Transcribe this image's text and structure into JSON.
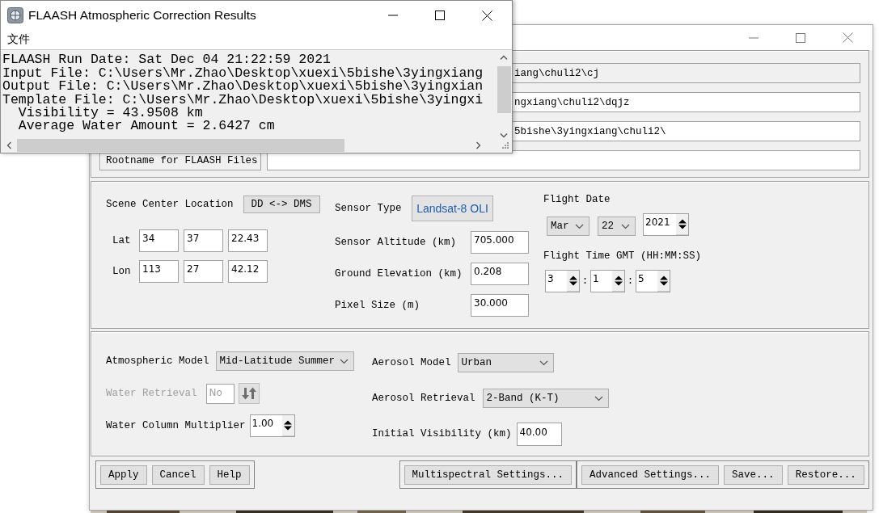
{
  "results_window": {
    "title": "FLAASH Atmospheric Correction Results",
    "menu": [
      "文件"
    ],
    "lines": [
      "FLAASH Run Date: Sat Dec 04 21:22:59 2021",
      "Input File: C:\\Users\\Mr.Zhao\\Desktop\\xuexi\\5bishe\\3yingxiang",
      "Output File: C:\\Users\\Mr.Zhao\\Desktop\\xuexi\\5bishe\\3yingxian",
      "Template File: C:\\Users\\Mr.Zhao\\Desktop\\xuexi\\5bishe\\3yingxi",
      "  Visibility = 43.9508 km",
      "  Average Water Amount = 2.6427 cm"
    ]
  },
  "flaash_dialog": {
    "file_fields": [
      {
        "value": "iang\\chuli2\\cj",
        "readonly": true
      },
      {
        "value": "ngxiang\\chuli2\\dqjz",
        "readonly": false
      },
      {
        "value": "5bishe\\3yingxiang\\chuli2\\",
        "readonly": false
      }
    ],
    "rootname": {
      "label": "Rootname for FLAASH Files"
    },
    "scene": {
      "label": "Scene Center Location",
      "toggle_button": "DD <-> DMS",
      "coordinates": [
        {
          "label": "Lat",
          "values": [
            "34",
            "37",
            "22.43"
          ]
        },
        {
          "label": "Lon",
          "values": [
            "113",
            "27",
            "42.12"
          ]
        }
      ]
    },
    "sensor": {
      "type_label": "Sensor Type",
      "type_button": "Landsat-8 OLI",
      "fields": [
        {
          "label": "Sensor Altitude (km)",
          "value": "705.000"
        },
        {
          "label": "Ground Elevation (km)",
          "value": "0.208"
        },
        {
          "label": "Pixel Size (m)",
          "value": "30.000"
        }
      ]
    },
    "flight_date": {
      "label": "Flight Date",
      "month": "Mar",
      "day": "22",
      "year": "2021"
    },
    "flight_time": {
      "label": "Flight Time GMT (HH:MM:SS)",
      "parts": [
        "3",
        "1",
        "5"
      ],
      "separators": [
        ":",
        ":"
      ]
    },
    "atmosphere": {
      "left": [
        {
          "kind": "dropdown",
          "label": "Atmospheric Model",
          "value": "Mid-Latitude Summer",
          "disabled": false
        },
        {
          "kind": "toggle",
          "label": "Water Retrieval",
          "value": "No",
          "disabled": true
        },
        {
          "kind": "spinner",
          "label": "Water Column Multiplier",
          "value": "1.00",
          "disabled": false
        }
      ],
      "right": [
        {
          "kind": "dropdown",
          "label": "Aerosol Model",
          "value": "Urban",
          "disabled": false
        },
        {
          "kind": "dropdown",
          "label": "Aerosol Retrieval",
          "value": "2-Band (K-T)",
          "disabled": false
        },
        {
          "kind": "text",
          "label": "Initial Visibility (km)",
          "value": "40.00",
          "disabled": false
        }
      ]
    },
    "button_groups": [
      [
        "Apply",
        "Cancel",
        "Help"
      ],
      [
        "Multispectral Settings..."
      ],
      [
        "Advanced Settings...",
        "Save...",
        "Restore..."
      ]
    ]
  }
}
